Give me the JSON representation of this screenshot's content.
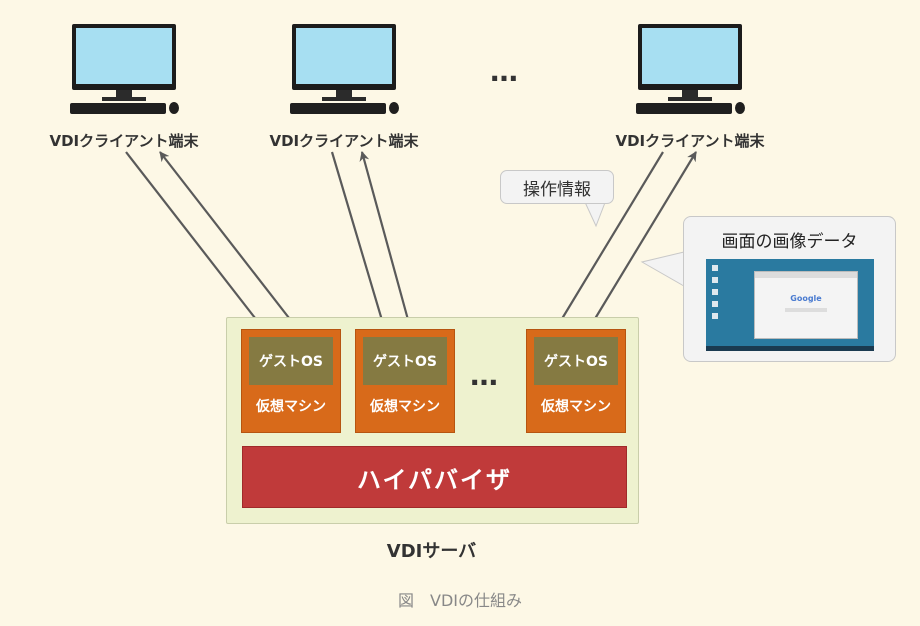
{
  "clients": [
    {
      "label": "VDIクライアント端末"
    },
    {
      "label": "VDIクライアント端末"
    },
    {
      "label": "VDIクライアント端末"
    }
  ],
  "top_ellipsis": "…",
  "middle_ellipsis": "…",
  "callouts": {
    "operation": "操作情報",
    "screen_image": "画面の画像データ",
    "google_logo": "Google"
  },
  "vms": [
    {
      "guest": "ゲストOS",
      "label": "仮想マシン"
    },
    {
      "guest": "ゲストOS",
      "label": "仮想マシン"
    },
    {
      "guest": "ゲストOS",
      "label": "仮想マシン"
    }
  ],
  "hypervisor": "ハイパバイザ",
  "server_label": "VDIサーバ",
  "caption": "図　VDIの仕組み",
  "colors": {
    "background": "#fdf8e6",
    "server_box": "#eef2cf",
    "vm_orange": "#d86a1a",
    "guest_olive": "#857a42",
    "hypervisor_red": "#c03a3a",
    "arrow": "#5a5a5a"
  }
}
